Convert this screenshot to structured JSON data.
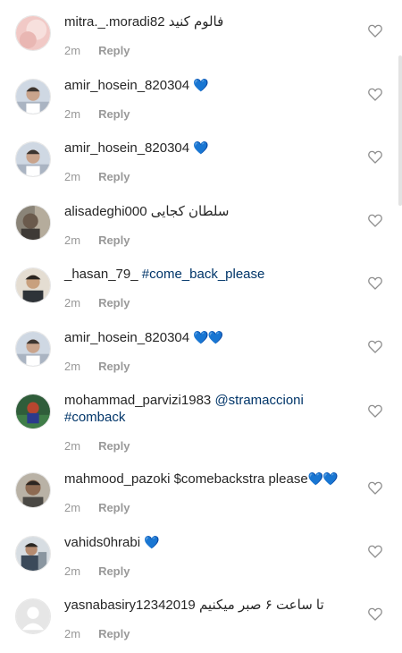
{
  "comments": [
    {
      "user": "mitra._.moradi82",
      "text": "فالوم کنید",
      "time": "2m",
      "reply": "Reply"
    },
    {
      "user": "amir_hosein_820304",
      "emoji": "💙",
      "time": "2m",
      "reply": "Reply"
    },
    {
      "user": "amir_hosein_820304",
      "emoji": "💙",
      "time": "2m",
      "reply": "Reply"
    },
    {
      "user": "alisadeghi000",
      "text": "سلطان کجایی",
      "time": "2m",
      "reply": "Reply"
    },
    {
      "user": "_hasan_79_",
      "tag": "#come_back_please",
      "time": "2m",
      "reply": "Reply"
    },
    {
      "user": "amir_hosein_820304",
      "emoji": "💙💙",
      "time": "2m",
      "reply": "Reply"
    },
    {
      "user": "mohammad_parvizi1983",
      "tag": "@stramaccioni",
      "tag2": "#comback",
      "time": "2m",
      "reply": "Reply"
    },
    {
      "user": "mahmood_pazoki",
      "text": "$comebackstra please",
      "emoji": "💙💙",
      "time": "2m",
      "reply": "Reply"
    },
    {
      "user": "vahids0hrabi",
      "emoji": "💙",
      "time": "2m",
      "reply": "Reply"
    },
    {
      "user": "yasnabasiry12342019",
      "text": "تا ساعت ۶ صبر میکنیم",
      "time": "2m",
      "reply": "Reply"
    }
  ]
}
